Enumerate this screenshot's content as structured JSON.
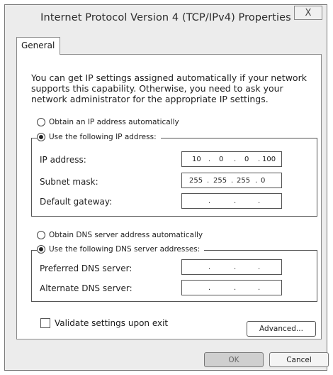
{
  "window": {
    "title": "Internet Protocol Version 4  (TCP/IPv4) Properties",
    "close_label": "X"
  },
  "tabs": [
    {
      "label": "General",
      "active": true
    }
  ],
  "intro_text": "You can get IP settings assigned automatically if your network supports this capability. Otherwise, you need to ask your network administrator for the appropriate IP settings.",
  "ip_mode": {
    "auto_label": "Obtain an IP address automatically",
    "manual_label": "Use the following IP address:",
    "selected": "manual"
  },
  "ip_fields": [
    {
      "label": "IP address:",
      "octets": [
        "10",
        "0",
        "0",
        "100"
      ]
    },
    {
      "label": "Subnet mask:",
      "octets": [
        "255",
        "255",
        "255",
        "0"
      ]
    },
    {
      "label": "Default gateway:",
      "octets": [
        "",
        "",
        "",
        ""
      ]
    }
  ],
  "dns_mode": {
    "auto_label": "Obtain DNS server address automatically",
    "manual_label": "Use the following DNS server addresses:",
    "selected": "manual"
  },
  "dns_fields": [
    {
      "label": "Preferred DNS server:",
      "octets": [
        "",
        "",
        "",
        ""
      ]
    },
    {
      "label": "Alternate DNS server:",
      "octets": [
        "",
        "",
        "",
        ""
      ]
    }
  ],
  "validate_label": "Validate settings upon exit",
  "validate_checked": false,
  "advanced_label": "Advanced...",
  "ok_label": "OK",
  "cancel_label": "Cancel"
}
